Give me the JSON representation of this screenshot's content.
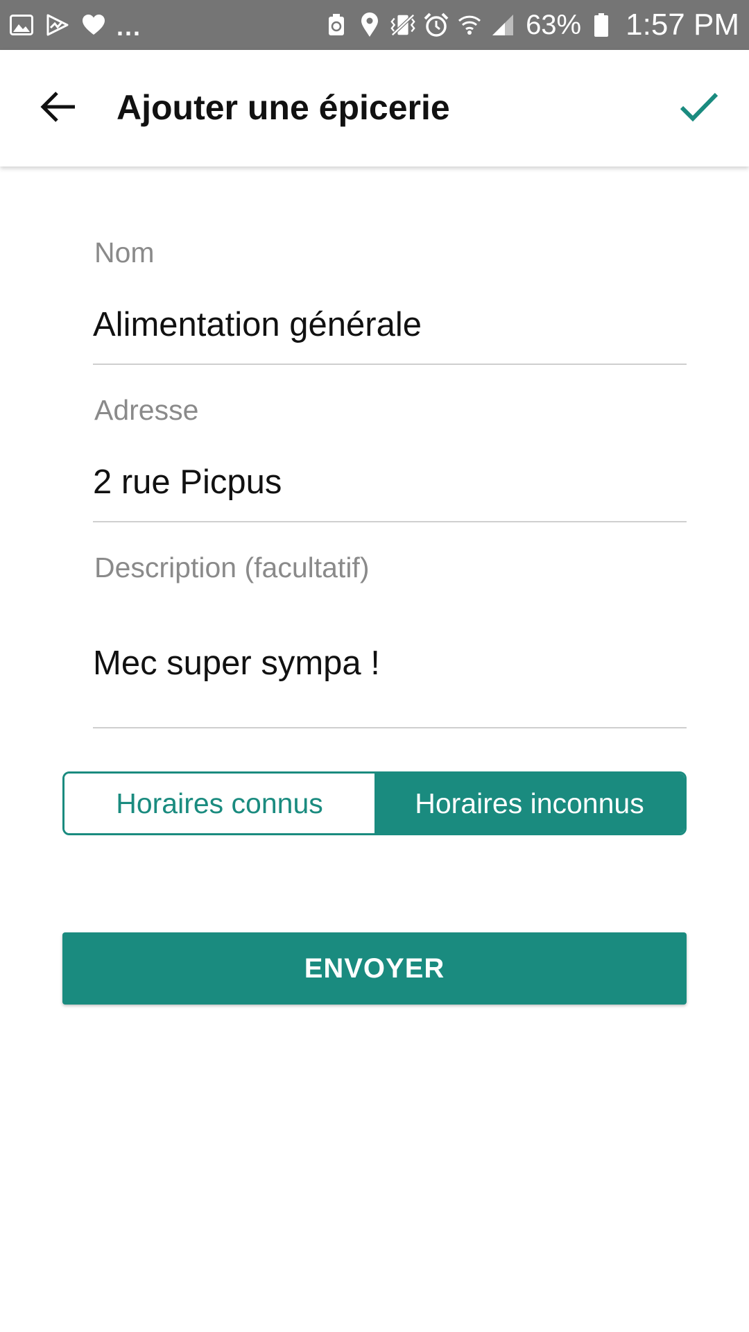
{
  "status_bar": {
    "left_icons": [
      "gallery-icon",
      "play-store-icon",
      "heart-icon"
    ],
    "overflow": "...",
    "right_icons": [
      "recycle-icon",
      "location-icon",
      "vibrate-icon",
      "alarm-icon",
      "wifi-icon",
      "signal-icon",
      "battery-icon"
    ],
    "battery_percent": "63%",
    "time": "1:57 PM"
  },
  "app_bar": {
    "title": "Ajouter une épicerie",
    "back_icon": "arrow-back-icon",
    "confirm_icon": "check-icon"
  },
  "form": {
    "name": {
      "label": "Nom",
      "value": "Alimentation générale"
    },
    "address": {
      "label": "Adresse",
      "value": "2 rue Picpus"
    },
    "description": {
      "label": "Description (facultatif)",
      "value": "Mec super sympa !"
    }
  },
  "hours_toggle": {
    "options": [
      "Horaires connus",
      "Horaires inconnus"
    ],
    "selected": "Horaires inconnus"
  },
  "submit": {
    "label": "ENVOYER"
  },
  "colors": {
    "accent": "#1a8b7f",
    "status_bar": "#757575",
    "label": "#8a8a8a",
    "divider": "#cfcfcf"
  }
}
